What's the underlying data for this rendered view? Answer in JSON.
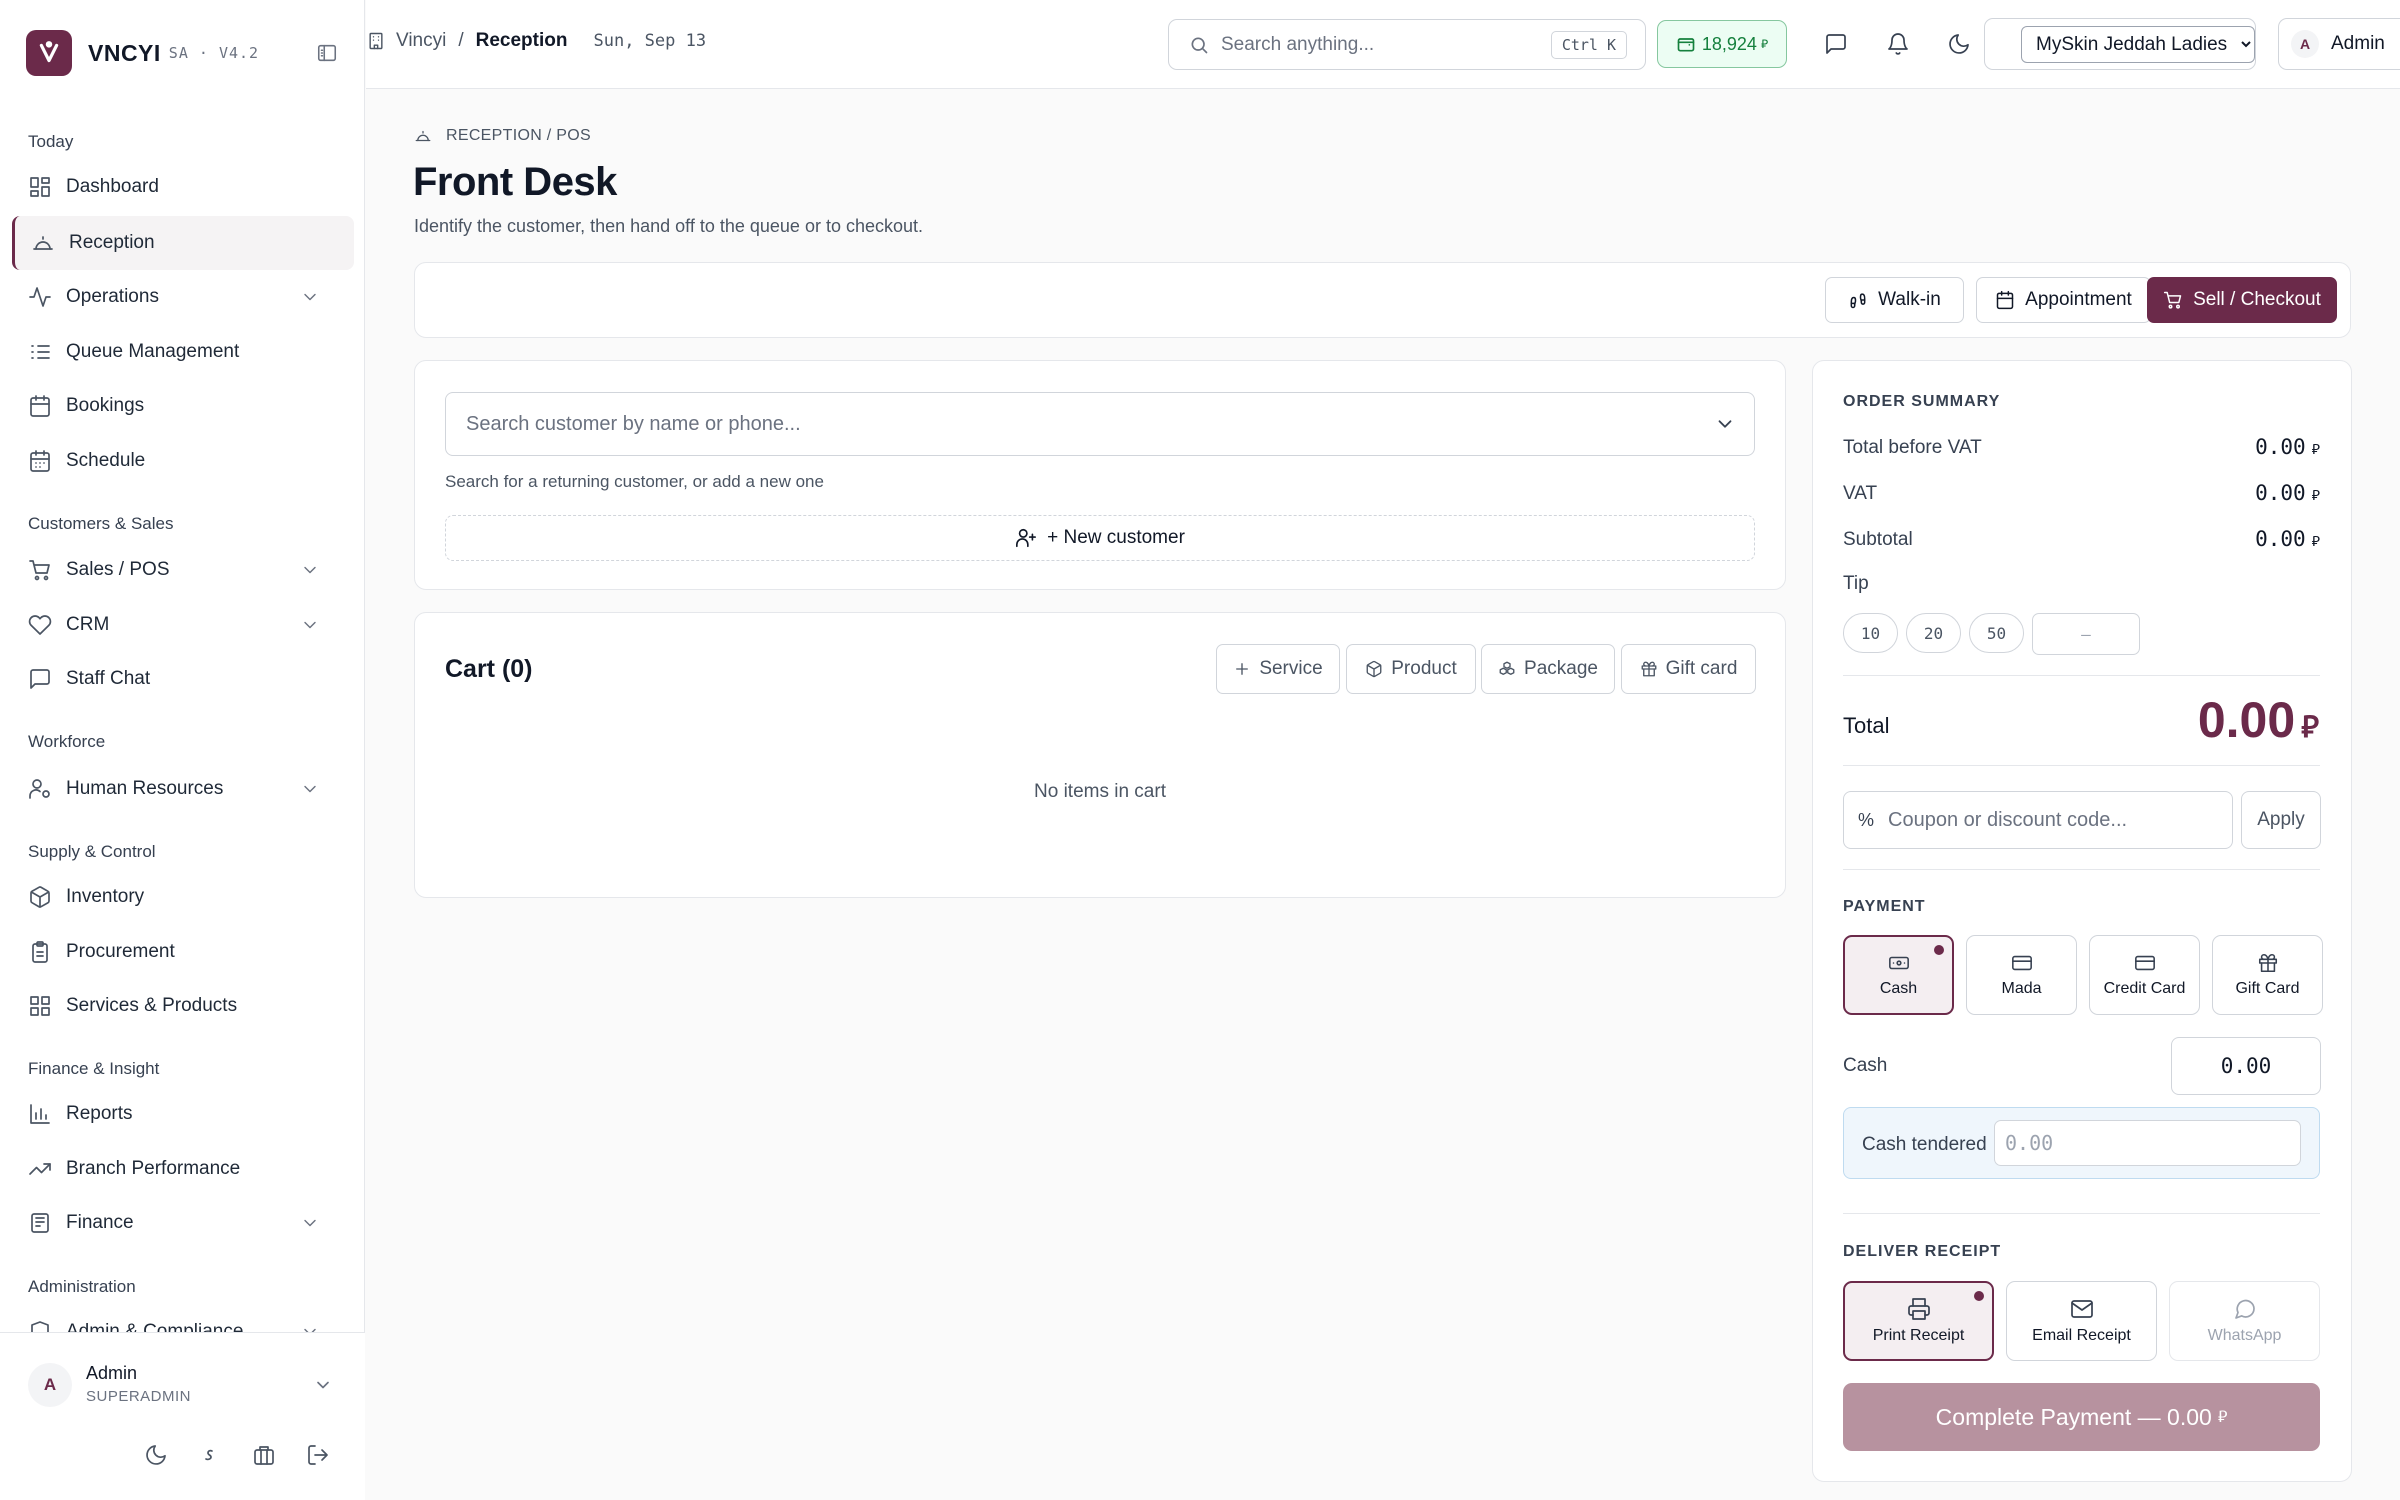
{
  "app": {
    "name": "VNCYI",
    "version": "SA · V4.2"
  },
  "sidebar": {
    "sections": [
      {
        "label": "Today"
      },
      {
        "label": "Customers & Sales"
      },
      {
        "label": "Workforce"
      },
      {
        "label": "Supply & Control"
      },
      {
        "label": "Finance & Insight"
      },
      {
        "label": "Administration"
      }
    ],
    "items": [
      {
        "label": "Dashboard",
        "icon": "grid-icon"
      },
      {
        "label": "Reception",
        "icon": "bell-concierge-icon",
        "active": true
      },
      {
        "label": "Operations",
        "icon": "activity-icon",
        "expandable": true
      },
      {
        "label": "Queue Management",
        "icon": "list-ordered-icon"
      },
      {
        "label": "Bookings",
        "icon": "calendar-icon"
      },
      {
        "label": "Schedule",
        "icon": "calendar-days-icon"
      },
      {
        "label": "Sales / POS",
        "icon": "cart-icon",
        "expandable": true
      },
      {
        "label": "CRM",
        "icon": "heart-icon",
        "expandable": true
      },
      {
        "label": "Staff Chat",
        "icon": "chat-icon"
      },
      {
        "label": "Human Resources",
        "icon": "user-cog-icon",
        "expandable": true
      },
      {
        "label": "Inventory",
        "icon": "package-icon"
      },
      {
        "label": "Procurement",
        "icon": "clipboard-icon"
      },
      {
        "label": "Services & Products",
        "icon": "grid-icon"
      },
      {
        "label": "Reports",
        "icon": "bar-chart-icon"
      },
      {
        "label": "Branch Performance",
        "icon": "trending-up-icon"
      },
      {
        "label": "Finance",
        "icon": "wallet-icon",
        "expandable": true
      },
      {
        "label": "Admin & Compliance",
        "icon": "shield-icon",
        "expandable": true
      }
    ],
    "user": {
      "initial": "A",
      "name": "Admin",
      "role": "SUPERADMIN"
    }
  },
  "topbar": {
    "breadcrumb": {
      "root": "Vincyi",
      "current": "Reception"
    },
    "date": "Sun, Sep 13",
    "search_placeholder": "Search anything...",
    "search_shortcut": "Ctrl K",
    "balance": "18,924",
    "branch": "MySkin Jeddah Ladies",
    "user": {
      "initial": "A",
      "name": "Admin"
    }
  },
  "page": {
    "eyebrow": "RECEPTION / POS",
    "title": "Front Desk",
    "subtitle": "Identify the customer, then hand off to the queue or to checkout.",
    "actions": {
      "walk_in": "Walk-in",
      "appointment": "Appointment",
      "checkout": "Sell / Checkout"
    }
  },
  "customer": {
    "placeholder": "Search customer by name or phone...",
    "hint": "Search for a returning customer, or add a new one",
    "new_label": "+ New customer"
  },
  "cart": {
    "title": "Cart (0)",
    "buttons": {
      "service": "Service",
      "product": "Product",
      "package": "Package",
      "gift_card": "Gift card"
    },
    "empty": "No items in cart"
  },
  "summary": {
    "title": "ORDER SUMMARY",
    "rows": [
      {
        "label": "Total before VAT",
        "value": "0.00"
      },
      {
        "label": "VAT",
        "value": "0.00"
      },
      {
        "label": "Subtotal",
        "value": "0.00"
      }
    ],
    "tip_label": "Tip",
    "tips": [
      "10",
      "20",
      "50"
    ],
    "tip_custom": "—",
    "total_label": "Total",
    "total": "0.00",
    "coupon_placeholder": "Coupon or discount code...",
    "apply": "Apply",
    "payment_title": "PAYMENT",
    "methods": [
      {
        "label": "Cash",
        "icon": "banknote-icon",
        "selected": true
      },
      {
        "label": "Mada",
        "icon": "card-icon"
      },
      {
        "label": "Credit Card",
        "icon": "credit-card-icon"
      },
      {
        "label": "Gift Card",
        "icon": "gift-icon"
      }
    ],
    "cash_label": "Cash",
    "cash_value": "0.00",
    "tendered_label": "Cash tendered",
    "tendered_placeholder": "0.00",
    "receipt_title": "DELIVER RECEIPT",
    "receipts": [
      {
        "label": "Print Receipt",
        "icon": "printer-icon",
        "selected": true
      },
      {
        "label": "Email Receipt",
        "icon": "mail-icon"
      },
      {
        "label": "WhatsApp",
        "icon": "whatsapp-icon",
        "disabled": true
      }
    ],
    "complete": "Complete Payment — 0.00"
  },
  "colors": {
    "brand": "#6b2a4a",
    "success": "#16a34a",
    "muted_brand": "#b7929f"
  }
}
